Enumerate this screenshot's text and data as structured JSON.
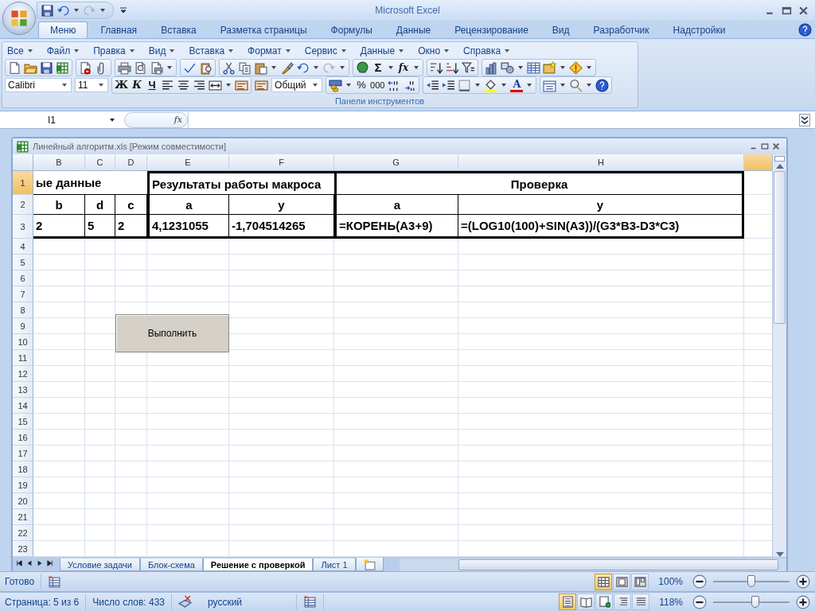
{
  "window": {
    "title": "Microsoft Excel"
  },
  "ribbon_tabs": [
    {
      "label": "Меню",
      "selected": true
    },
    {
      "label": "Главная",
      "selected": false
    },
    {
      "label": "Вставка",
      "selected": false
    },
    {
      "label": "Разметка страницы",
      "selected": false
    },
    {
      "label": "Формулы",
      "selected": false
    },
    {
      "label": "Данные",
      "selected": false
    },
    {
      "label": "Рецензирование",
      "selected": false
    },
    {
      "label": "Вид",
      "selected": false
    },
    {
      "label": "Разработчик",
      "selected": false
    },
    {
      "label": "Надстройки",
      "selected": false
    }
  ],
  "menus": [
    "Все",
    "Файл",
    "Правка",
    "Вид",
    "Вставка",
    "Формат",
    "Сервис",
    "Данные",
    "Окно",
    "Справка"
  ],
  "toolbar": {
    "sum": "Σ",
    "function": "fx",
    "font": "Calibri",
    "font_size": "11",
    "bold": "Ж",
    "italic": "К",
    "underline": "Ч",
    "number_format": "Общий",
    "percent": "%",
    "thousands": "000",
    "font_color": "A",
    "group_label": "Панели инструментов"
  },
  "formula_bar": {
    "name_box": "I1",
    "function_label": "fx"
  },
  "workbook": {
    "title": "Линейный алгоритм.xls  [Режим совместимости]",
    "columns": [
      {
        "label": "B",
        "selected": false
      },
      {
        "label": "C",
        "selected": false
      },
      {
        "label": "D",
        "selected": false
      },
      {
        "label": "E",
        "selected": false
      },
      {
        "label": "F",
        "selected": false
      },
      {
        "label": "G",
        "selected": false
      },
      {
        "label": "H",
        "selected": false
      }
    ],
    "partial_column": {
      "selected": true
    },
    "rows": [
      {
        "number": "1",
        "selected": true,
        "cells": [
          "ые данные",
          "Результаты работы макроса",
          "Проверка"
        ]
      },
      {
        "number": "2",
        "selected": false,
        "cells": [
          "b",
          "d",
          "c",
          "a",
          "y",
          "a",
          "y"
        ]
      },
      {
        "number": "3",
        "selected": false,
        "cells": [
          "2",
          "5",
          "2",
          "4,1231055",
          "-1,704514265",
          "=КОРЕНЬ(A3+9)",
          "=(LOG10(100)+SIN(A3))/(G3*B3-D3*C3)"
        ]
      },
      {
        "number": "4",
        "selected": false
      },
      {
        "number": "5",
        "selected": false
      },
      {
        "number": "6",
        "selected": false
      },
      {
        "number": "7",
        "selected": false
      },
      {
        "number": "8",
        "selected": false
      },
      {
        "number": "9",
        "selected": false
      },
      {
        "number": "10",
        "selected": false
      },
      {
        "number": "11",
        "selected": false
      },
      {
        "number": "12",
        "selected": false
      },
      {
        "number": "13",
        "selected": false
      },
      {
        "number": "14",
        "selected": false
      },
      {
        "number": "15",
        "selected": false
      },
      {
        "number": "16",
        "selected": false
      },
      {
        "number": "17",
        "selected": false
      },
      {
        "number": "18",
        "selected": false
      },
      {
        "number": "19",
        "selected": false
      },
      {
        "number": "20",
        "selected": false
      },
      {
        "number": "21",
        "selected": false
      },
      {
        "number": "22",
        "selected": false
      },
      {
        "number": "23",
        "selected": false
      }
    ],
    "button": {
      "label": "Выполнить"
    },
    "sheet_tabs": [
      {
        "label": "Условие задачи",
        "selected": false
      },
      {
        "label": "Блок-схема",
        "selected": false
      },
      {
        "label": "Решение с проверкой",
        "selected": true
      },
      {
        "label": "Лист 1",
        "selected": false
      }
    ]
  },
  "status_bar": {
    "text": "Готово",
    "zoom": "100%",
    "level": 0.5,
    "views": [
      {
        "selected": true
      },
      {
        "selected": false
      },
      {
        "selected": false
      }
    ]
  },
  "word_status_bar": {
    "page": "Страница: 5 из 6",
    "words": "Число слов: 433",
    "language": "русский",
    "zoom": "118%",
    "level": 0.55,
    "views": [
      {
        "selected": true
      },
      {
        "selected": false
      },
      {
        "selected": false
      },
      {
        "selected": false
      },
      {
        "selected": false
      }
    ]
  }
}
